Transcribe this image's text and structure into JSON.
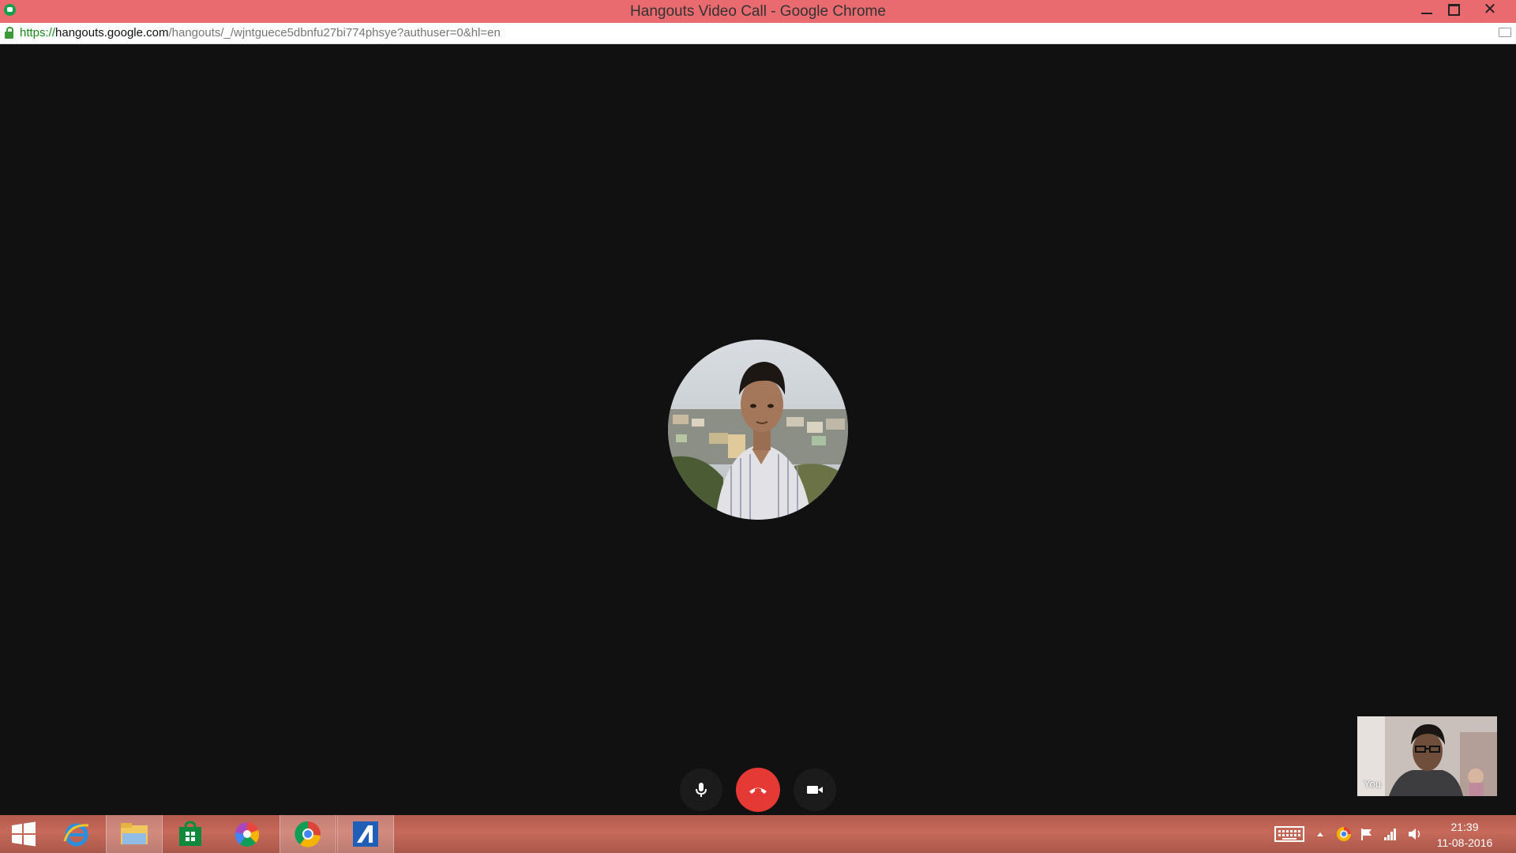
{
  "window": {
    "title": "Hangouts Video Call - Google Chrome",
    "minimize_icon": "minimize-icon",
    "maximize_icon": "restore-icon",
    "close_label": "✕"
  },
  "address_bar": {
    "url_scheme": "https://",
    "url_host": "hangouts.google.com",
    "url_path": "/hangouts/_/wjntguece5dbnfu27bi774phsye?authuser=0&hl=en"
  },
  "call": {
    "remote_avatar": "remote-participant-avatar",
    "self_view_label": "You",
    "controls": {
      "mic_icon": "microphone-icon",
      "hangup_icon": "hang-up-icon",
      "camera_icon": "video-camera-icon",
      "hangup_color": "#e53935"
    }
  },
  "taskbar": {
    "apps": [
      {
        "name": "start-button",
        "icon": "windows-logo-icon"
      },
      {
        "name": "internet-explorer",
        "icon": "internet-explorer-icon"
      },
      {
        "name": "file-explorer",
        "icon": "folder-icon"
      },
      {
        "name": "store",
        "icon": "store-bag-icon"
      },
      {
        "name": "picasa",
        "icon": "picasa-icon"
      },
      {
        "name": "google-chrome",
        "icon": "chrome-icon",
        "active": true
      },
      {
        "name": "app-a",
        "icon": "a-logo-icon"
      }
    ],
    "tray": {
      "clock_time": "21:39",
      "clock_date": "11-08-2016"
    }
  },
  "colors": {
    "titlebar": "#e96a6f",
    "stage": "#111111"
  }
}
